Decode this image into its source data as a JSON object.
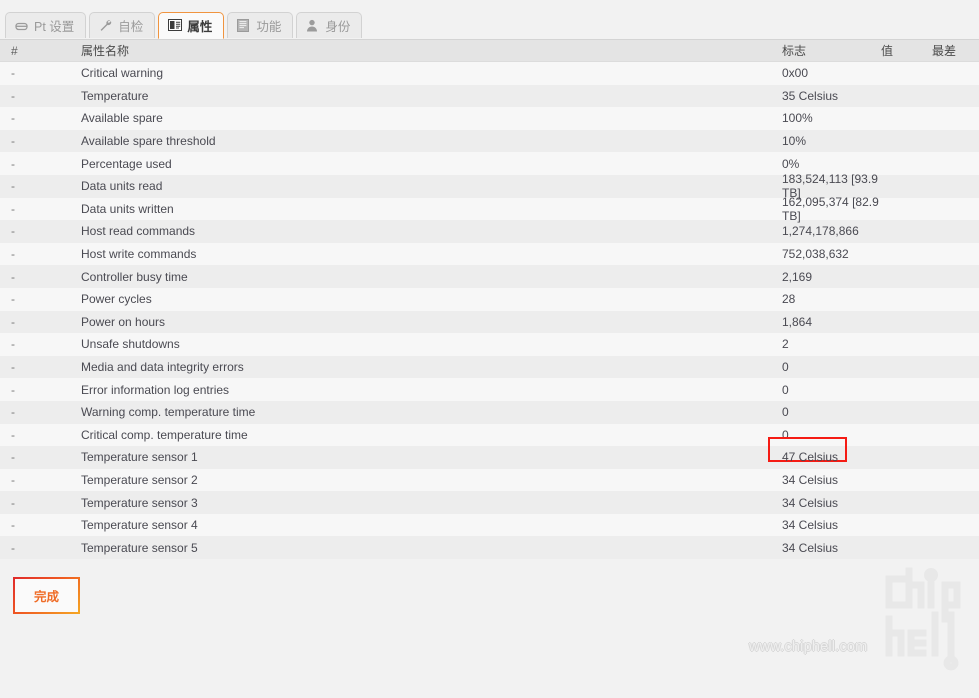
{
  "tabs": [
    {
      "label": "Pt 设置",
      "icon": "disk-icon",
      "active": false
    },
    {
      "label": "自检",
      "icon": "wrench-icon",
      "active": false
    },
    {
      "label": "属性",
      "icon": "id-card-icon",
      "active": true
    },
    {
      "label": "功能",
      "icon": "book-icon",
      "active": false
    },
    {
      "label": "身份",
      "icon": "person-icon",
      "active": false
    }
  ],
  "table": {
    "headers": {
      "index": "#",
      "name": "属性名称",
      "flag": "标志",
      "value": "值",
      "worst": "最差"
    },
    "rows": [
      {
        "index": "-",
        "name": "Critical warning",
        "flag": "0x00",
        "value": "",
        "worst": ""
      },
      {
        "index": "-",
        "name": "Temperature",
        "flag": "35 Celsius",
        "value": "",
        "worst": ""
      },
      {
        "index": "-",
        "name": "Available spare",
        "flag": "100%",
        "value": "",
        "worst": ""
      },
      {
        "index": "-",
        "name": "Available spare threshold",
        "flag": "10%",
        "value": "",
        "worst": ""
      },
      {
        "index": "-",
        "name": "Percentage used",
        "flag": "0%",
        "value": "",
        "worst": ""
      },
      {
        "index": "-",
        "name": "Data units read",
        "flag": "183,524,113 [93.9 TB]",
        "value": "",
        "worst": ""
      },
      {
        "index": "-",
        "name": "Data units written",
        "flag": "162,095,374 [82.9 TB]",
        "value": "",
        "worst": ""
      },
      {
        "index": "-",
        "name": "Host read commands",
        "flag": "1,274,178,866",
        "value": "",
        "worst": ""
      },
      {
        "index": "-",
        "name": "Host write commands",
        "flag": "752,038,632",
        "value": "",
        "worst": ""
      },
      {
        "index": "-",
        "name": "Controller busy time",
        "flag": "2,169",
        "value": "",
        "worst": ""
      },
      {
        "index": "-",
        "name": "Power cycles",
        "flag": "28",
        "value": "",
        "worst": ""
      },
      {
        "index": "-",
        "name": "Power on hours",
        "flag": "1,864",
        "value": "",
        "worst": ""
      },
      {
        "index": "-",
        "name": "Unsafe shutdowns",
        "flag": "2",
        "value": "",
        "worst": ""
      },
      {
        "index": "-",
        "name": "Media and data integrity errors",
        "flag": "0",
        "value": "",
        "worst": ""
      },
      {
        "index": "-",
        "name": "Error information log entries",
        "flag": "0",
        "value": "",
        "worst": ""
      },
      {
        "index": "-",
        "name": "Warning comp. temperature time",
        "flag": "0",
        "value": "",
        "worst": ""
      },
      {
        "index": "-",
        "name": "Critical comp. temperature time",
        "flag": "0",
        "value": "",
        "worst": ""
      },
      {
        "index": "-",
        "name": "Temperature sensor 1",
        "flag": "47 Celsius",
        "value": "",
        "worst": "",
        "highlight": true
      },
      {
        "index": "-",
        "name": "Temperature sensor 2",
        "flag": "34 Celsius",
        "value": "",
        "worst": ""
      },
      {
        "index": "-",
        "name": "Temperature sensor 3",
        "flag": "34 Celsius",
        "value": "",
        "worst": ""
      },
      {
        "index": "-",
        "name": "Temperature sensor 4",
        "flag": "34 Celsius",
        "value": "",
        "worst": ""
      },
      {
        "index": "-",
        "name": "Temperature sensor 5",
        "flag": "34 Celsius",
        "value": "",
        "worst": ""
      }
    ]
  },
  "footer": {
    "done_label": "完成"
  },
  "watermark": {
    "url": "www.chiphell.com",
    "logo_text": "chiphell"
  },
  "colors": {
    "accent": "#f0943f",
    "highlight": "#f51b14",
    "row_odd": "#f7f7f7",
    "row_even": "#ededed",
    "header_bg": "#e4e4e4",
    "page_bg": "#f2f2f2"
  }
}
